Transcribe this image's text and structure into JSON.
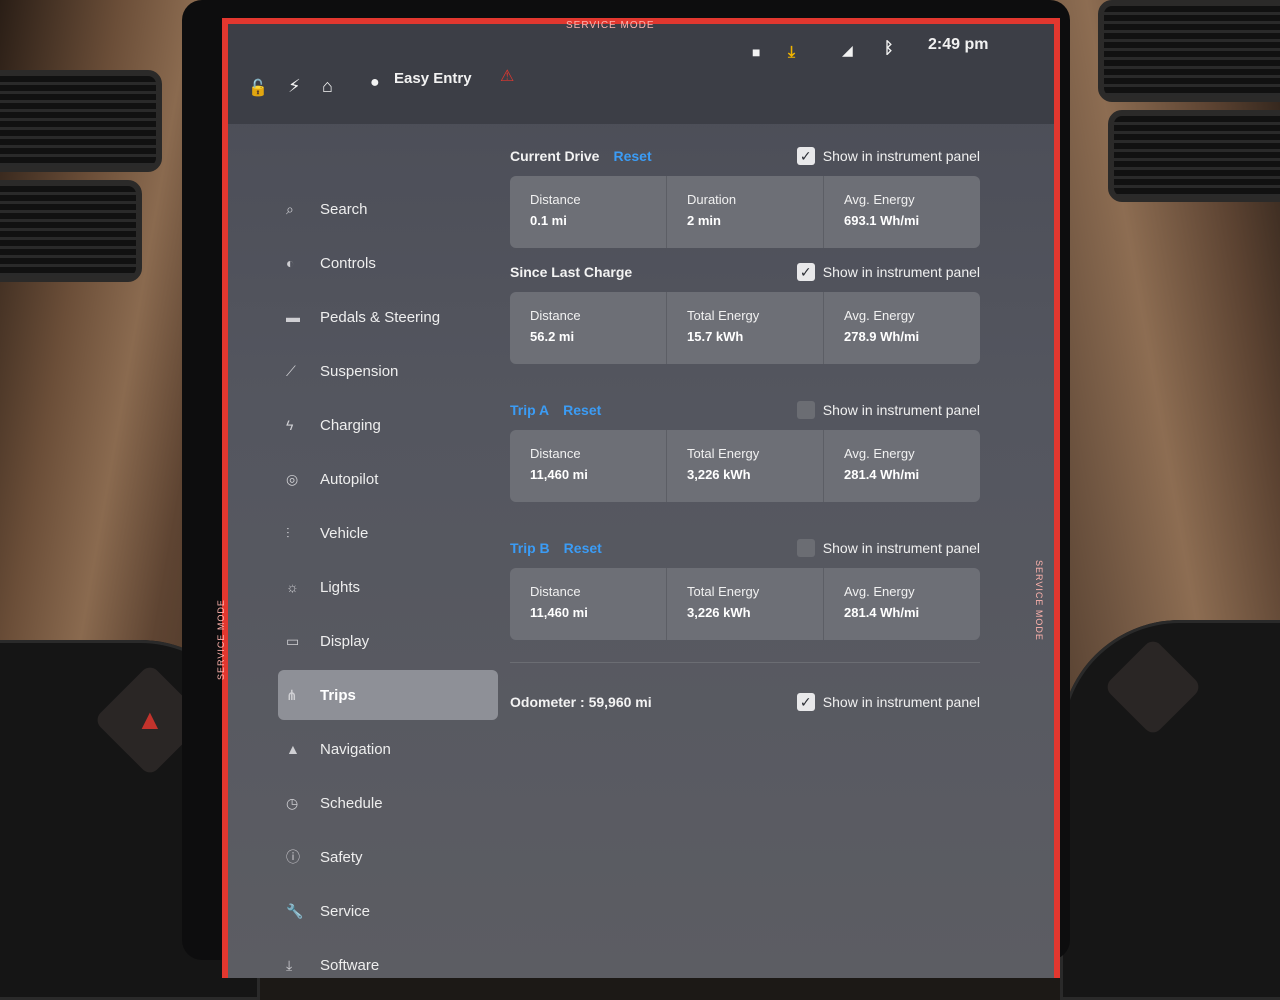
{
  "status_bar": {
    "profile": "Easy Entry",
    "time": "2:49 pm",
    "service_mode": "SERVICE MODE",
    "icons": [
      "lock-icon",
      "bolt-icon",
      "home-icon",
      "person-icon",
      "warning-icon",
      "camera-icon",
      "download-icon",
      "no-signal-icon",
      "bluetooth-icon"
    ]
  },
  "sidebar": {
    "items": [
      {
        "label": "Search",
        "icon": "search-icon"
      },
      {
        "label": "Controls",
        "icon": "toggle-icon"
      },
      {
        "label": "Pedals & Steering",
        "icon": "car-icon"
      },
      {
        "label": "Suspension",
        "icon": "wrench-icon"
      },
      {
        "label": "Charging",
        "icon": "bolt-icon"
      },
      {
        "label": "Autopilot",
        "icon": "steering-wheel-icon"
      },
      {
        "label": "Vehicle",
        "icon": "sliders-icon"
      },
      {
        "label": "Lights",
        "icon": "sun-icon"
      },
      {
        "label": "Display",
        "icon": "display-icon"
      },
      {
        "label": "Trips",
        "icon": "trips-icon",
        "active": true
      },
      {
        "label": "Navigation",
        "icon": "navigation-icon"
      },
      {
        "label": "Schedule",
        "icon": "clock-icon"
      },
      {
        "label": "Safety",
        "icon": "info-icon"
      },
      {
        "label": "Service",
        "icon": "wrench-icon"
      },
      {
        "label": "Software",
        "icon": "download-icon"
      }
    ]
  },
  "trips": {
    "current_drive": {
      "title": "Current Drive",
      "reset": "Reset",
      "show_label": "Show in instrument panel",
      "checked": true,
      "cells": [
        {
          "label": "Distance",
          "value": "0.1 mi"
        },
        {
          "label": "Duration",
          "value": "2 min"
        },
        {
          "label": "Avg. Energy",
          "value": "693.1 Wh/mi"
        }
      ]
    },
    "since_last_charge": {
      "title": "Since Last Charge",
      "show_label": "Show in instrument panel",
      "checked": true,
      "cells": [
        {
          "label": "Distance",
          "value": "56.2 mi"
        },
        {
          "label": "Total Energy",
          "value": "15.7 kWh"
        },
        {
          "label": "Avg. Energy",
          "value": "278.9 Wh/mi"
        }
      ]
    },
    "trip_a": {
      "title": "Trip A",
      "reset": "Reset",
      "show_label": "Show in instrument panel",
      "checked": false,
      "cells": [
        {
          "label": "Distance",
          "value": "11,460 mi"
        },
        {
          "label": "Total Energy",
          "value": "3,226 kWh"
        },
        {
          "label": "Avg. Energy",
          "value": "281.4 Wh/mi"
        }
      ]
    },
    "trip_b": {
      "title": "Trip B",
      "reset": "Reset",
      "show_label": "Show in instrument panel",
      "checked": false,
      "cells": [
        {
          "label": "Distance",
          "value": "11,460 mi"
        },
        {
          "label": "Total Energy",
          "value": "3,226 kWh"
        },
        {
          "label": "Avg. Energy",
          "value": "281.4 Wh/mi"
        }
      ]
    },
    "odometer": {
      "text": "Odometer : 59,960 mi",
      "show_label": "Show in instrument panel",
      "checked": true
    }
  },
  "colors": {
    "accent": "#3b9cf5",
    "service_border": "#e2372f",
    "alert_icon": "#f0b400"
  }
}
